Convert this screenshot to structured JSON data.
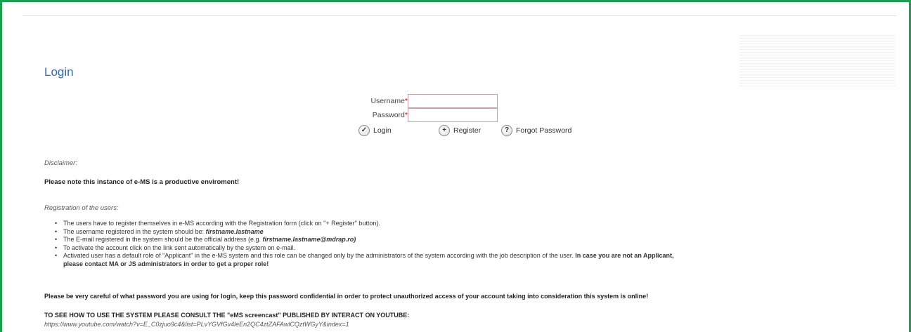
{
  "page": {
    "title": "Login"
  },
  "form": {
    "username_label": "Username",
    "password_label": "Password",
    "required_mark": "*",
    "username_value": "",
    "password_value": ""
  },
  "actions": {
    "login": "Login",
    "register": "Register",
    "forgot": "Forgot Password"
  },
  "disclaimer": {
    "heading": "Disclaimer:",
    "text": "Please note this instance of e-MS is a productive enviroment!"
  },
  "registration": {
    "heading": "Registration of the users:",
    "item1": "The users have to register themselves in e-MS according with the Registration form (click on \"+ Register\" button).",
    "item2_prefix": "The username registered in the system should be: ",
    "item2_em": "firstname.lastname",
    "item3_prefix": "The E-mail registered in the system should be the official address (e.g. ",
    "item3_em": "firstname.lastname@mdrap.ro)",
    "item4": "To activate the account click on the link sent automatically by the system on e-mail.",
    "item5_prefix": "Activated user has a default role of \"Applicant\" in the e-MS system and this role can be changed only by the administrators of the system according with the job description of the user. ",
    "item5_bold": "In case you are not an Applicant,",
    "item5_cont": "please contact MA or JS administrators in order to get a proper role!"
  },
  "warning": "Please be very careful of what password you are using for login, keep this password confidential in order to protect unauthorized access of your account taking into consideration this system is online!",
  "screencast": {
    "heading": "TO SEE HOW TO USE THE SYSTEM PLEASE CONSULT THE \"eMS screencast\" PUBLISHED BY INTERACT ON YOUTUBE:",
    "url": "https://www.youtube.com/watch?v=E_C0zjuo9c4&list=PLvYGVfGv4leEn2QC4ztZAFAwlCQztWGyY&index=1"
  },
  "colors": {
    "frame": "#1e9e50",
    "title": "#2a6bb0",
    "required": "#dd0000"
  }
}
